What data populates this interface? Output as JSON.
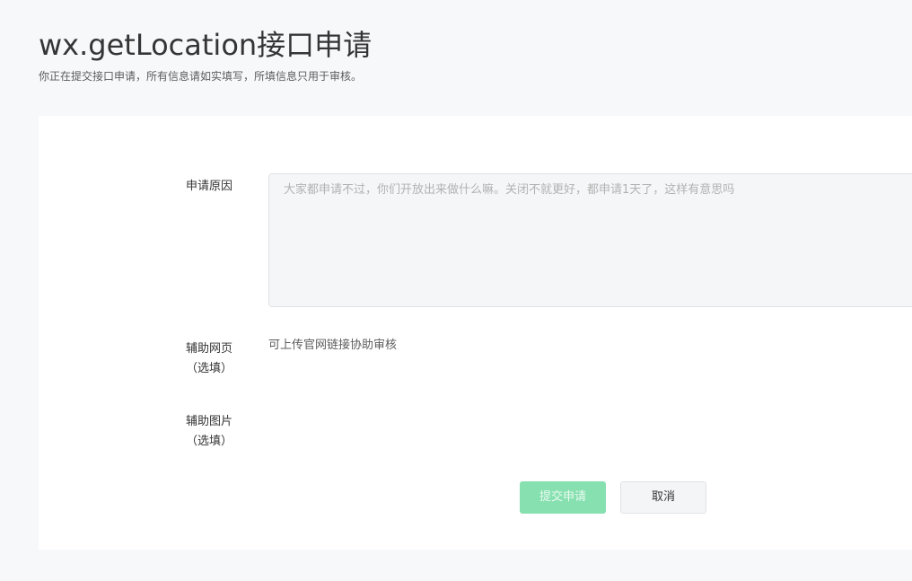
{
  "header": {
    "title": "wx.getLocation接口申请",
    "description": "你正在提交接口申请，所有信息请如实填写，所填信息只用于审核。"
  },
  "form": {
    "reason": {
      "label": "申请原因",
      "placeholder": "大家都申请不过，你们开放出来做什么嘛。关闭不就更好，都申请1天了，这样有意思吗"
    },
    "web": {
      "label": "辅助网页",
      "optional": "（选填）",
      "hint": "可上传官网链接协助审核"
    },
    "image": {
      "label": "辅助图片",
      "optional": "（选填）"
    }
  },
  "actions": {
    "submit_label": "提交申请",
    "cancel_label": "取消"
  },
  "colors": {
    "page_background": "#f7f8fa",
    "card_background": "#ffffff",
    "submit_disabled_green": "#87e0b0"
  }
}
